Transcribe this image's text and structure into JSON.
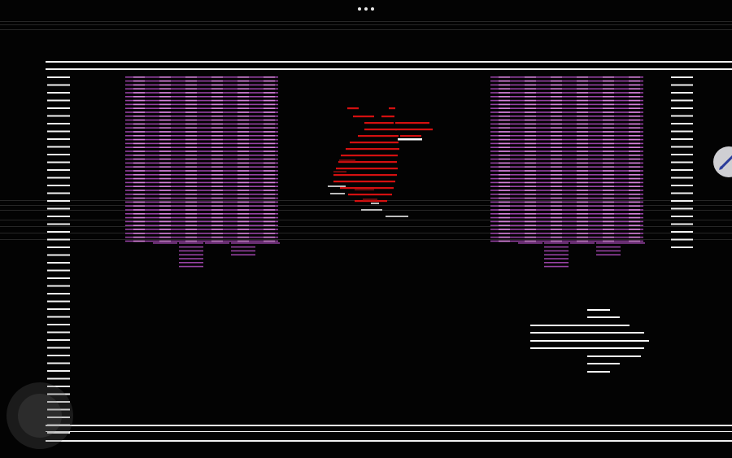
{
  "colors": {
    "background": "#030303",
    "frame": "#f2f2f2",
    "curtain": "#b04ec0",
    "curtain_highlight": "#dc8ae0",
    "character": "#d41010",
    "character_dark": "#6a0c0c",
    "character_metal": "#bdbdbd",
    "arrow": "#ffffff",
    "scanline": "#2a2a2a"
  },
  "icons": {
    "menu": "more-dots-icon",
    "edit": "pencil-icon",
    "joystick": "joystick-icon",
    "next": "arrow-right-icon"
  },
  "scene": {
    "name": "pirate-cove-stage",
    "character": "foxy-animatronic",
    "curtains": [
      "left-curtain",
      "right-curtain"
    ],
    "navigation_arrow_direction": "right"
  }
}
